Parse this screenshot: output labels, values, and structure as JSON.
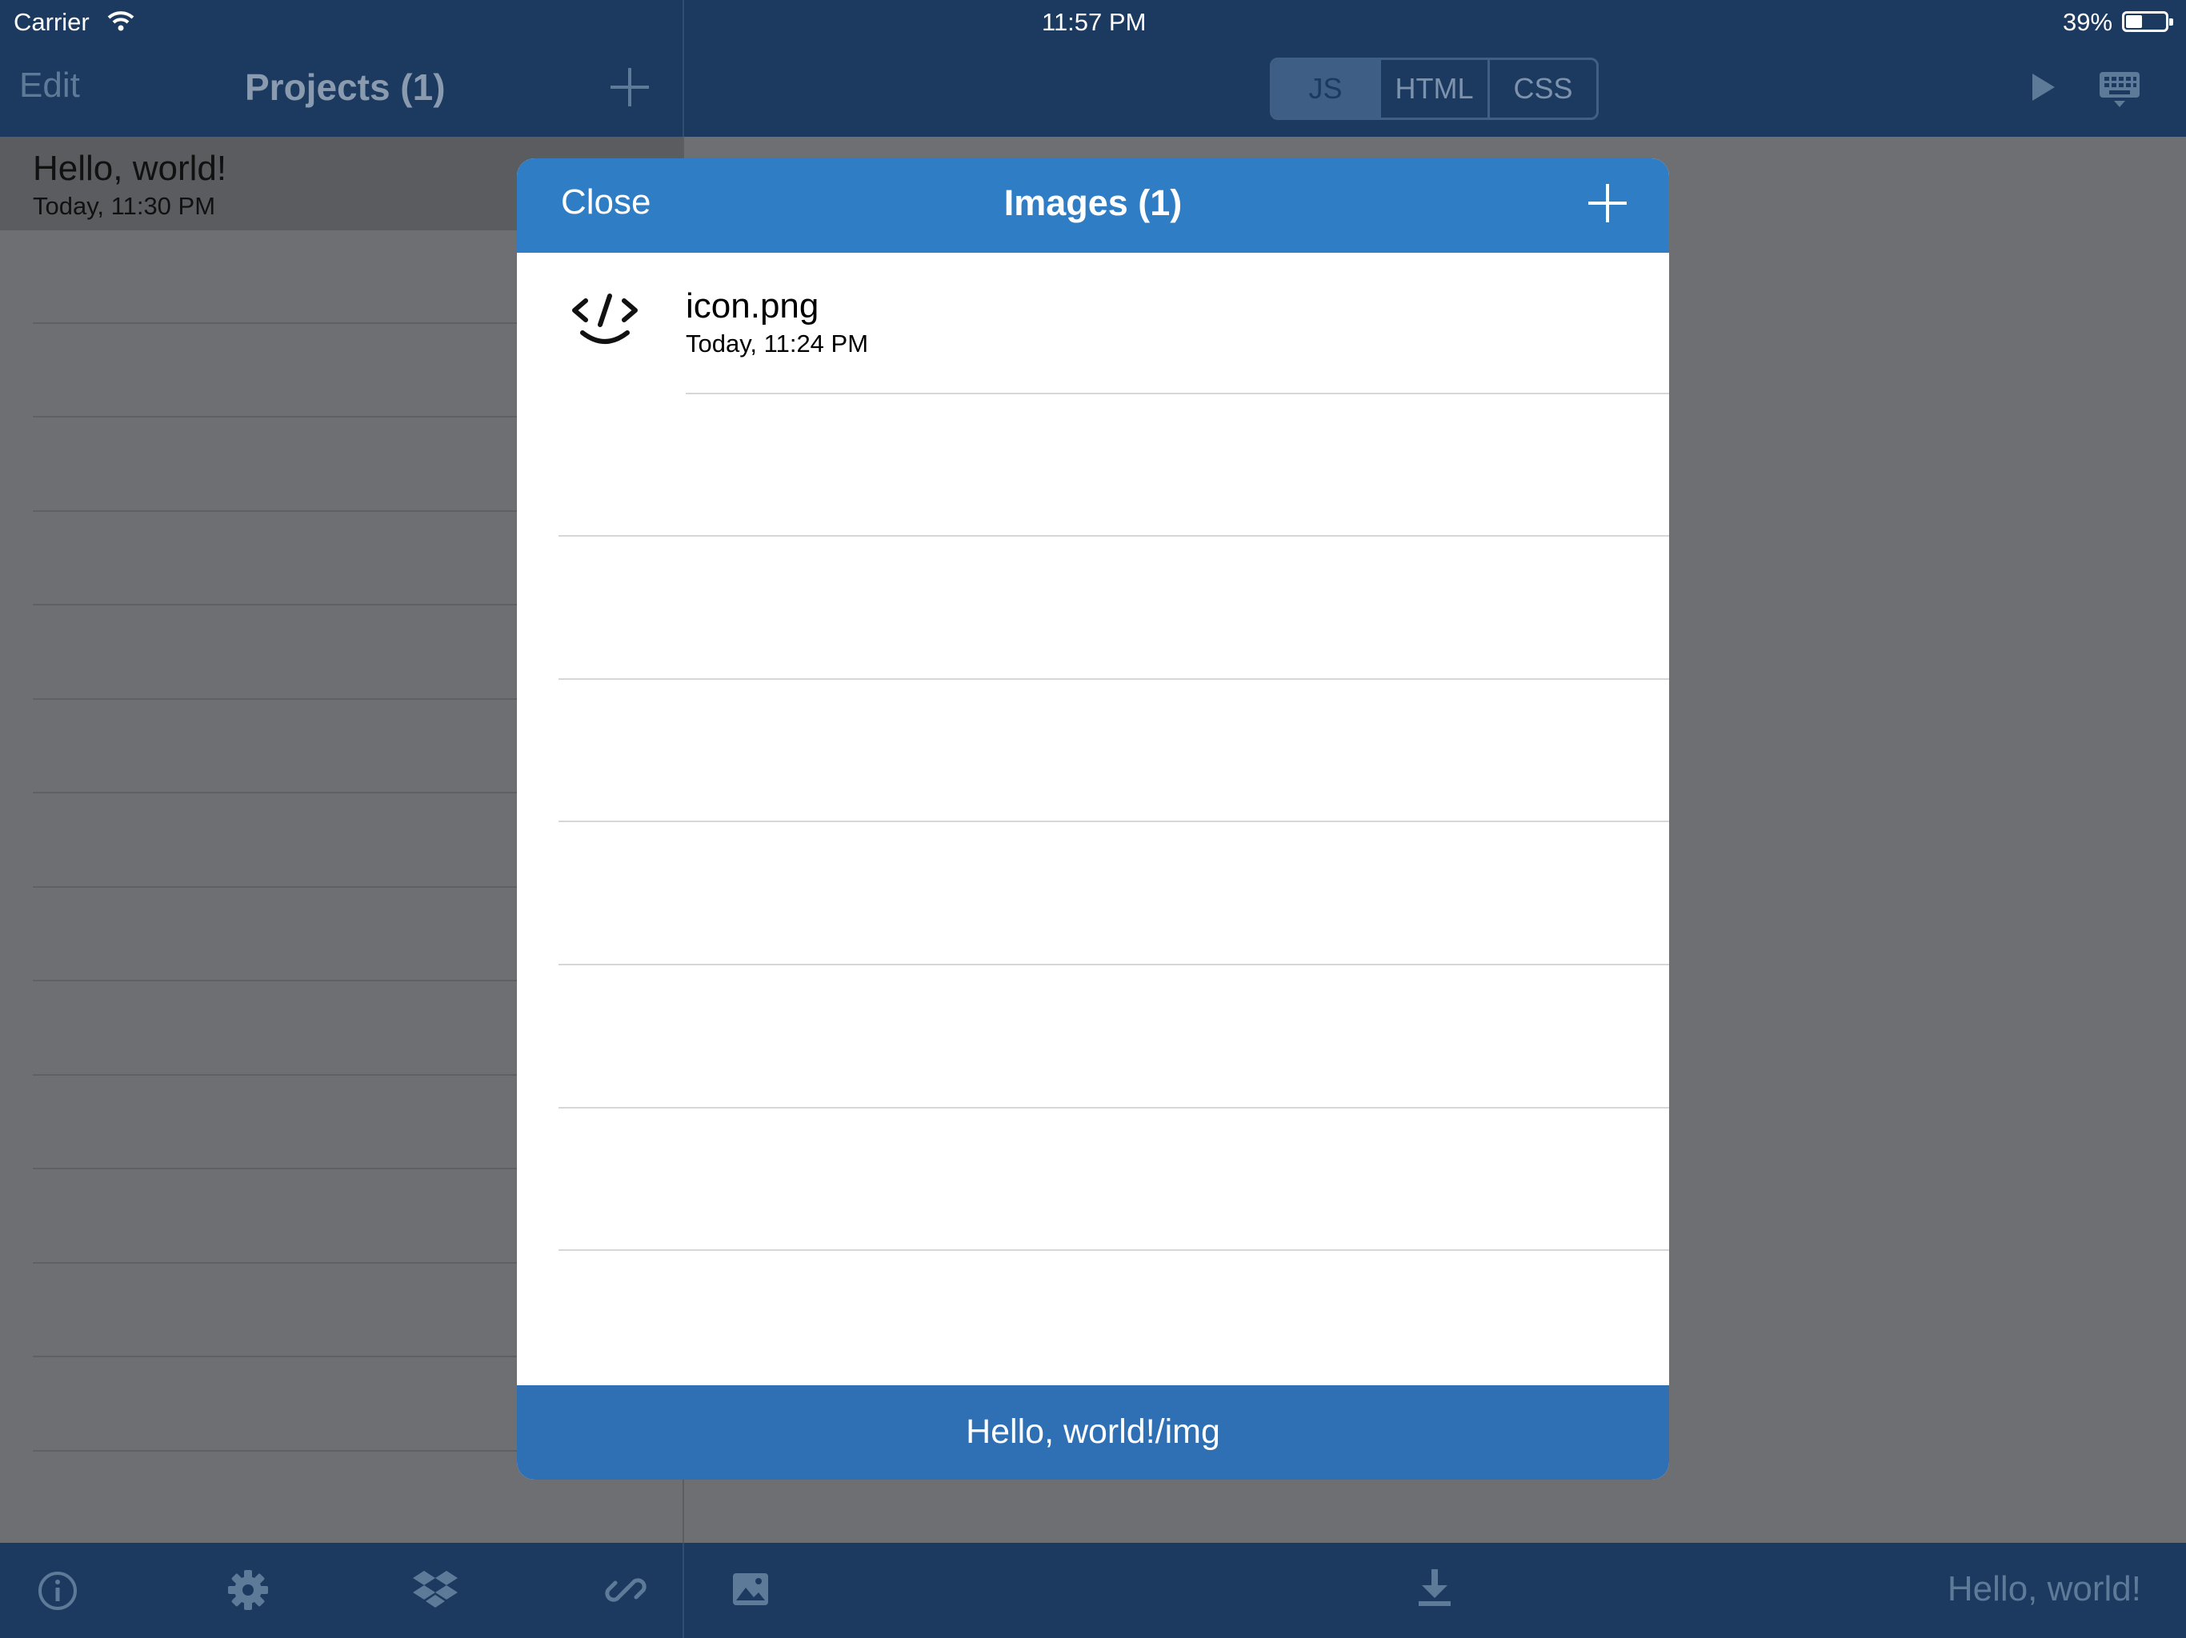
{
  "status_bar": {
    "carrier": "Carrier",
    "time": "11:57 PM",
    "battery": "39%"
  },
  "sidebar": {
    "edit_label": "Edit",
    "title": "Projects (1)",
    "projects": [
      {
        "title": "Hello, world!",
        "date": "Today, 11:30 PM"
      }
    ]
  },
  "editor": {
    "segments": [
      "JS",
      "HTML",
      "CSS"
    ],
    "selected_segment": "JS",
    "document_name": "Hello, world!"
  },
  "modal": {
    "close_label": "Close",
    "title": "Images (1)",
    "files": [
      {
        "name": "icon.png",
        "date": "Today, 11:24 PM",
        "icon": "code-smile-icon"
      }
    ],
    "footer_path": "Hello, world!/img"
  },
  "toolbar_icons": [
    "info-icon",
    "gear-icon",
    "dropbox-icon",
    "link-icon",
    "image-icon",
    "download-icon"
  ],
  "colors": {
    "nav": "#1c3a5f",
    "modal_header": "#2f7dc4",
    "modal_footer": "#2f6fb4",
    "dim": "#6e6f73"
  }
}
